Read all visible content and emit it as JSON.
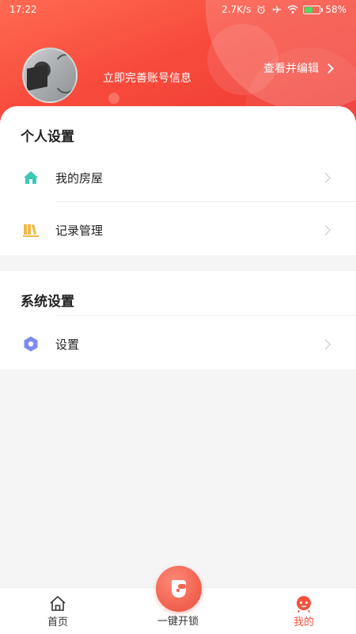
{
  "status_bar": {
    "time": "17:22",
    "network_speed": "2.7K/s",
    "battery": "58%",
    "battery_level": 0.58,
    "icons": [
      "alarm-icon",
      "airplane-icon",
      "wifi-icon",
      "battery-icon"
    ]
  },
  "profile": {
    "hint": "立即完善账号信息",
    "edit_label": "查看并编辑"
  },
  "personal_settings": {
    "title": "个人设置",
    "items": [
      {
        "label": "我的房屋",
        "icon": "house-icon"
      },
      {
        "label": "记录管理",
        "icon": "records-icon"
      }
    ]
  },
  "system_settings": {
    "title": "系统设置",
    "items": [
      {
        "label": "设置",
        "icon": "settings-hexagon-icon"
      }
    ]
  },
  "tab_bar": {
    "home_label": "首页",
    "unlock_label": "一键开锁",
    "mine_label": "我的"
  },
  "colors": {
    "accent": "#f2523e",
    "house_icon": "#3fc7b4",
    "records_icon": "#f0b84a",
    "settings_icon": "#7b8cf0"
  }
}
